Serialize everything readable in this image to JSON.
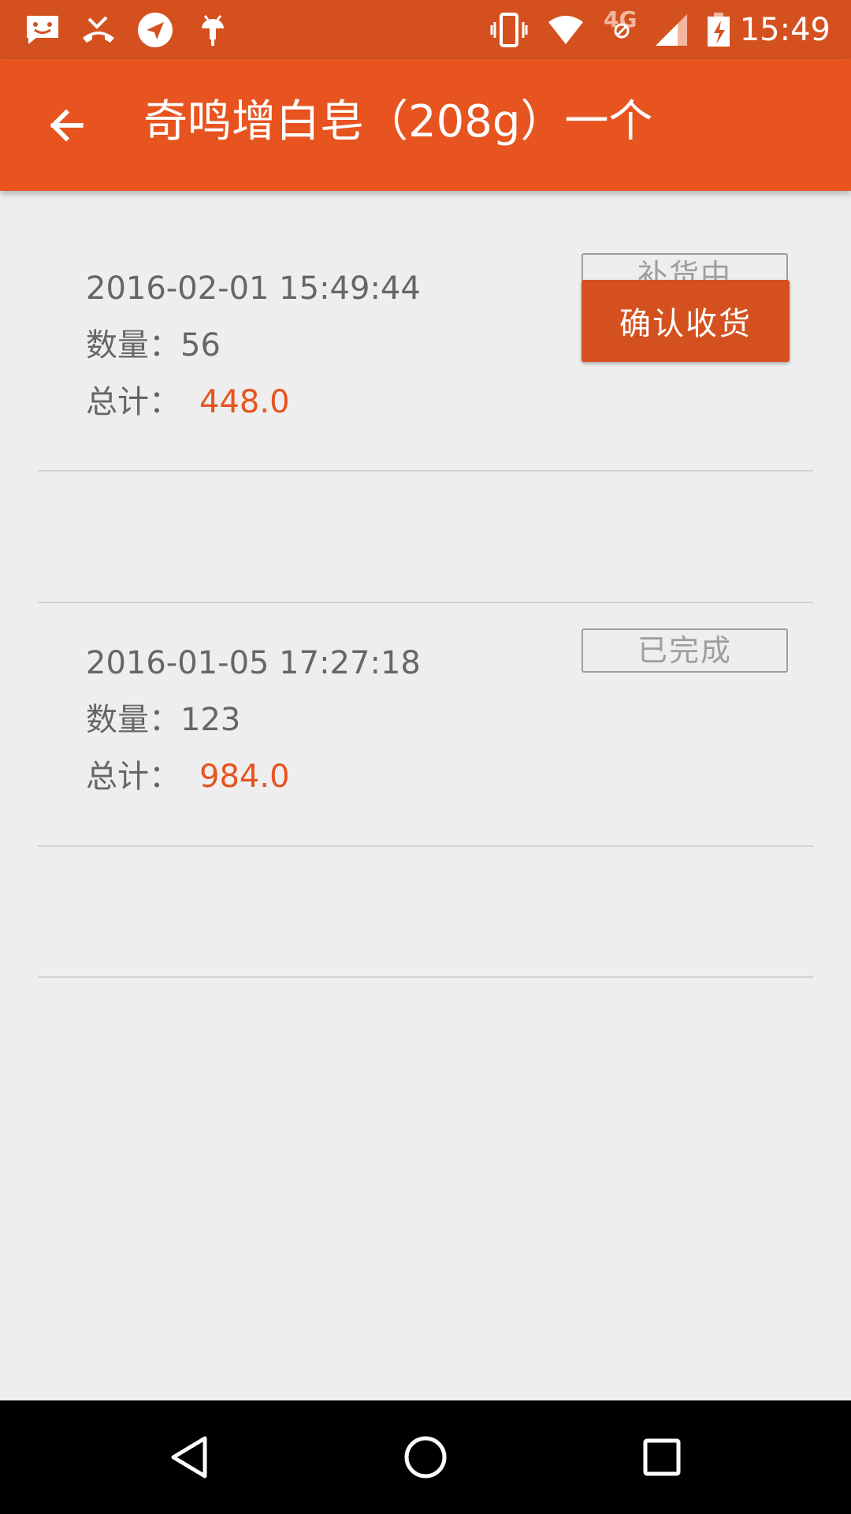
{
  "status_bar": {
    "time": "15:49",
    "network_label": "4G",
    "left_icons": [
      "chat-notification-icon",
      "missed-call-icon",
      "send-icon",
      "android-debug-icon"
    ],
    "right_icons": [
      "vibrate-icon",
      "wifi-icon",
      "mobile-data-icon",
      "cell-signal-icon",
      "battery-charging-icon"
    ]
  },
  "app_bar": {
    "title": "奇鸣增白皂（208g）一个",
    "back_icon": "arrow-back-icon"
  },
  "orders": [
    {
      "datetime": "2016-02-01 15:49:44",
      "quantity_label": "数量：",
      "quantity": "56",
      "total_label": "总计：",
      "total": "448.0",
      "status": "补货中",
      "action_label": "确认收货"
    },
    {
      "datetime": "2016-01-05 17:27:18",
      "quantity_label": "数量：",
      "quantity": "123",
      "total_label": "总计：",
      "total": "984.0",
      "status": "已完成"
    }
  ],
  "nav_bar": {
    "icons": [
      "back-triangle-icon",
      "home-circle-icon",
      "recents-square-icon"
    ]
  },
  "colors": {
    "status_bar": "#d4511f",
    "app_bar": "#e75420",
    "accent": "#e75420",
    "background": "#eeeeee",
    "text_secondary": "#666666",
    "badge_border": "#9e9e9e"
  }
}
